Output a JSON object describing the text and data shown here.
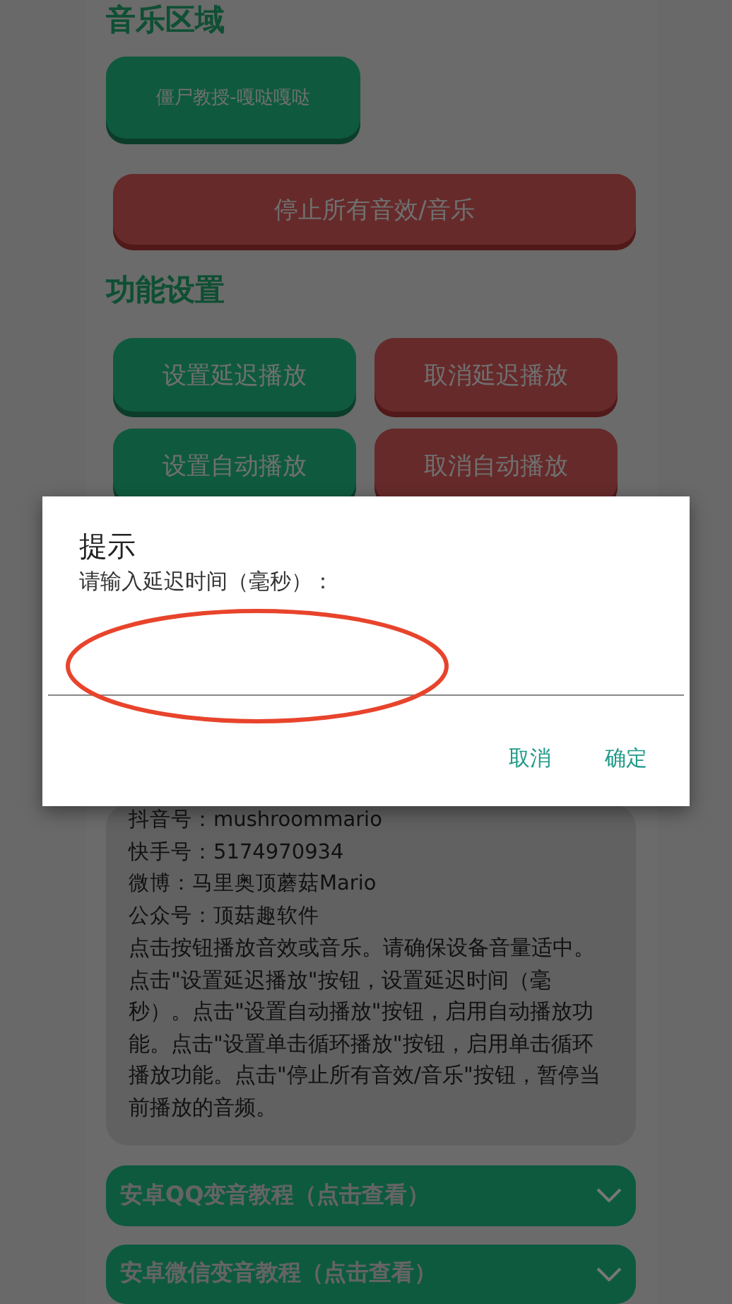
{
  "music_section": {
    "heading": "音乐区域",
    "sound_buttons": [
      {
        "label": "僵尸教授-嘎哒嘎哒"
      }
    ],
    "stop_button": {
      "label": "停止所有音效/音乐"
    }
  },
  "settings_section": {
    "heading": "功能设置",
    "buttons": [
      {
        "label": "设置延迟播放",
        "kind": "set"
      },
      {
        "label": "取消延迟播放",
        "kind": "cancel"
      },
      {
        "label": "设置自动播放",
        "kind": "set"
      },
      {
        "label": "取消自动播放",
        "kind": "cancel"
      }
    ]
  },
  "info_card": {
    "lines": [
      "抖音号：mushroommario",
      "快手号：5174970934",
      "微博：马里奥顶蘑菇Mario",
      "公众号：顶菇趣软件"
    ],
    "description": "点击按钮播放音效或音乐。请确保设备音量适中。点击\"设置延迟播放\"按钮，设置延迟时间（毫秒）。点击\"设置自动播放\"按钮，启用自动播放功能。点击\"设置单击循环播放\"按钮，启用单击循环播放功能。点击\"停止所有音效/音乐\"按钮，暂停当前播放的音频。"
  },
  "accordions": [
    {
      "title": "安卓QQ变音教程（点击查看）",
      "expanded": false
    },
    {
      "title": "安卓微信变音教程（点击查看）",
      "expanded": false
    }
  ],
  "dialog": {
    "title": "提示",
    "message": "请输入延迟时间（毫秒）：",
    "buttons": [
      {
        "label": "取消"
      },
      {
        "label": "确定"
      }
    ]
  }
}
